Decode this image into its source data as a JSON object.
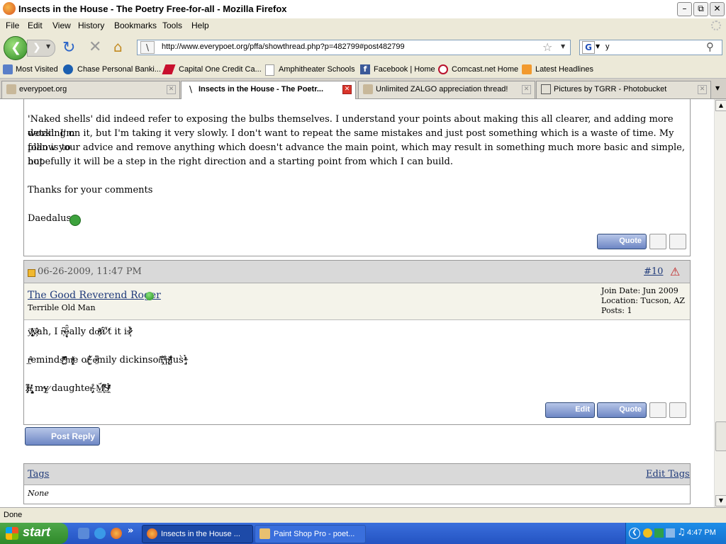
{
  "window": {
    "title": "Insects in the House - The Poetry Free-for-all - Mozilla Firefox"
  },
  "menu": [
    "File",
    "Edit",
    "View",
    "History",
    "Bookmarks",
    "Tools",
    "Help"
  ],
  "nav": {
    "url": "http://www.everypoet.org/pffa/showthread.php?p=482799#post482799",
    "search_value": "y"
  },
  "bookmarks": [
    "Most Visited",
    "Chase Personal Banki...",
    "Capital One Credit Ca...",
    "Amphitheater Schools",
    "Facebook | Home",
    "Comcast.net Home",
    "Latest Headlines"
  ],
  "tabs": [
    {
      "label": "everypoet.org"
    },
    {
      "label": "Insects in the House - The Poetr..."
    },
    {
      "label": "Unlimited ZALGO appreciation thread!"
    },
    {
      "label": "Pictures by TGRR - Photobucket"
    }
  ],
  "post1": {
    "lines": [
      "'Naked shells' did indeed refer to exposing the bulbs themselves. I understand your points about making this all clearer, and adding more detail. I'm",
      "working on it, but I'm taking it very slowly. I don't want to repeat the same mistakes and just post something which is a waste of time. My plan is to",
      "follow your advice and remove anything which doesn't advance the main point, which may result in something much more basic and simple, but",
      "hopefully it will be a step in the right direction and a starting point from which I can build."
    ],
    "thanks": "Thanks for your comments",
    "signature": "Daedalus",
    "quote_label": "Quote"
  },
  "post2": {
    "date": "06-26-2009, 11:47 PM",
    "post_number": "#10",
    "username": "The Good Reverend Roger",
    "user_title": "Terrible Old Man",
    "join_date": "Join Date: Jun 2009",
    "location": "Location: Tucson, AZ",
    "posts": "Posts: 1",
    "lines": [
      "ȳ̷̧̢̤̻͑ͬ̎ͤ̇ͅẏ̷̷̧ͦ̔̑ah, I r̵̞͆ȩ̶̦̟̋̑ally do̴̸̖ͧ̎ń̷̑'̋t̸ it is̷̷̝̞͋ͩͪ̉",
      "r̶̲ͦ̑eminds̸̨̫̫͗ͦ̆ͭ͊ ̧̤̽̄ͩ̂ͤ̆m̸̡̢̜̻ͦ̍ͯ͐e of̶̴̨̹̺͋͑ ̸̀e̴̷̫ͬ͆̓mily dickinson̶̢̡̂̊̆͌ ͨͥ͋p̸̶̨̨̺ͦ̆̃̎lus̀ ̶̡̱͉̇ͪ̉ͬͤ",
      "̷̸̡̨͆͑ͤ̇ͣa̴̢ͭ̽̽̍ ̧̺my̴̢ ̷daughter̡̙̫ͭ͋ ̶M̸̨̱̲͆̈́̐ͭS̸̯̲̉ͩ̎͊ͬͤ"
    ],
    "edit_label": "Edit",
    "quote_label": "Quote"
  },
  "post_reply_label": "Post Reply",
  "tags": {
    "header": "Tags",
    "edit": "Edit Tags",
    "value": "None"
  },
  "status": "Done",
  "taskbar": {
    "start": "start",
    "tasks": [
      "Insects in the House ...",
      "Paint Shop Pro - poet..."
    ],
    "clock": "4:47 PM"
  }
}
